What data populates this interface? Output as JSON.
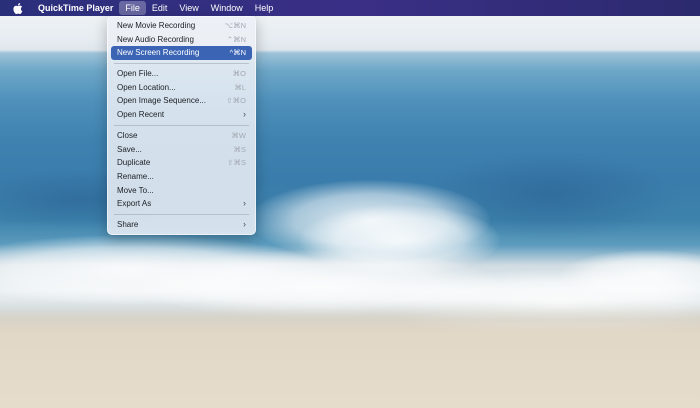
{
  "menubar": {
    "apple_icon": "apple-logo-icon",
    "items": [
      {
        "label": "QuickTime Player"
      },
      {
        "label": "File"
      },
      {
        "label": "Edit"
      },
      {
        "label": "View"
      },
      {
        "label": "Window"
      },
      {
        "label": "Help"
      }
    ]
  },
  "file_menu": {
    "groups": [
      [
        {
          "label": "New Movie Recording",
          "shortcut": "⌥⌘N"
        },
        {
          "label": "New Audio Recording",
          "shortcut": "⌃⌘N"
        },
        {
          "label": "New Screen Recording",
          "shortcut": "^⌘N"
        }
      ],
      [
        {
          "label": "Open File...",
          "shortcut": "⌘O"
        },
        {
          "label": "Open Location...",
          "shortcut": "⌘L"
        },
        {
          "label": "Open Image Sequence...",
          "shortcut": "⇧⌘O"
        },
        {
          "label": "Open Recent",
          "submenu": "›"
        }
      ],
      [
        {
          "label": "Close",
          "shortcut": "⌘W"
        },
        {
          "label": "Save...",
          "shortcut": "⌘S"
        },
        {
          "label": "Duplicate",
          "shortcut": "⇧⌘S"
        },
        {
          "label": "Rename..."
        },
        {
          "label": "Move To..."
        },
        {
          "label": "Export As",
          "submenu": "›"
        }
      ],
      [
        {
          "label": "Share",
          "submenu": "›"
        }
      ]
    ]
  },
  "colors": {
    "menubar": "#2f2d7c",
    "selection": "#3b64b4",
    "sea": "#3f82b0",
    "sand": "#e6dccb"
  }
}
